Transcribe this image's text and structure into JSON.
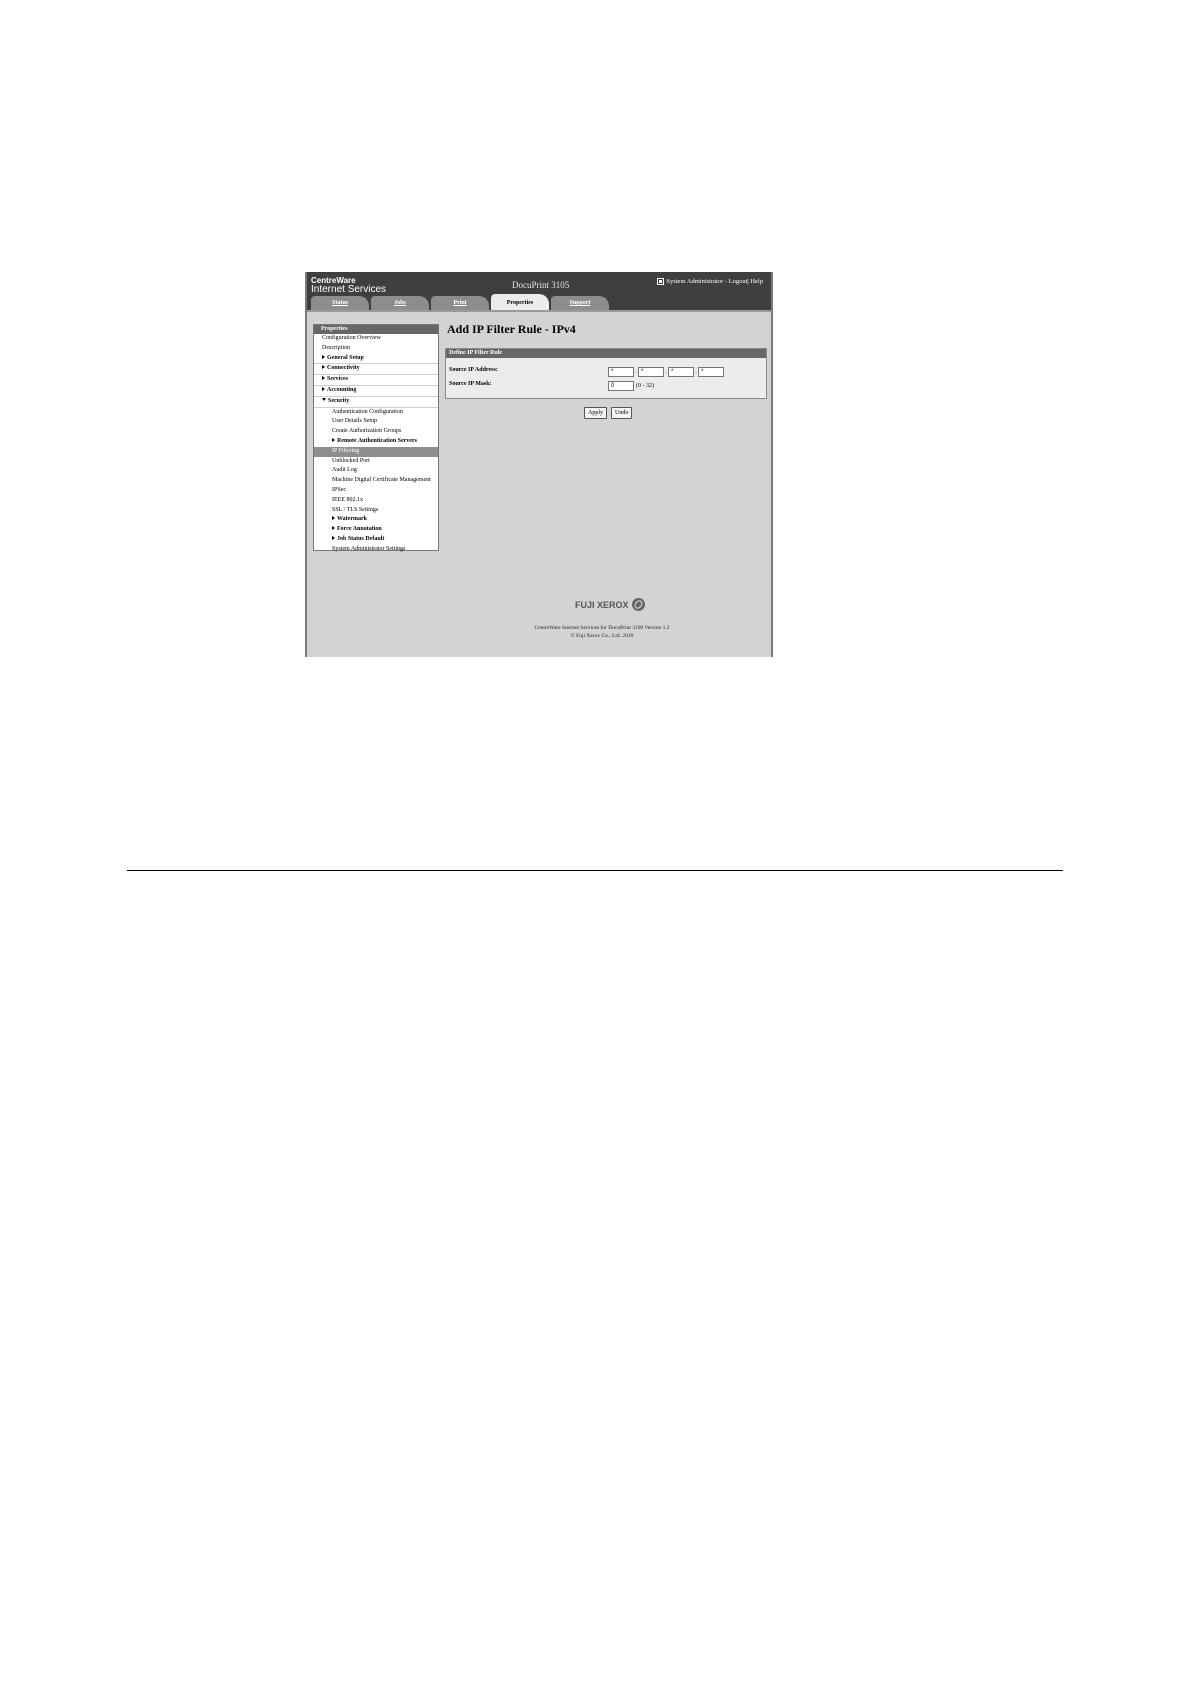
{
  "app": {
    "logo_line1": "CentreWare",
    "logo_line2": "Internet Services",
    "product": "DocuPrint 3105",
    "user_text": "System Administrator - Logout| Help"
  },
  "tabs": [
    {
      "label": "Status",
      "active": false
    },
    {
      "label": "Jobs",
      "active": false
    },
    {
      "label": "Print",
      "active": false
    },
    {
      "label": "Properties",
      "active": true
    },
    {
      "label": "Support",
      "active": false
    }
  ],
  "sidebar": {
    "header": "Properties",
    "items": [
      {
        "label": "Configuration Overview",
        "level": 1,
        "bold": false,
        "expand": "",
        "selected": false
      },
      {
        "label": "Description",
        "level": 1,
        "bold": false,
        "expand": "",
        "selected": false
      },
      {
        "label": "General Setup",
        "level": 1,
        "bold": true,
        "expand": "right",
        "selected": false
      },
      {
        "label": "Connectivity",
        "level": 1,
        "bold": true,
        "expand": "right",
        "selected": false
      },
      {
        "label": "Services",
        "level": 1,
        "bold": true,
        "expand": "right",
        "selected": false
      },
      {
        "label": "Accounting",
        "level": 1,
        "bold": true,
        "expand": "right",
        "selected": false
      },
      {
        "label": "Security",
        "level": 1,
        "bold": true,
        "expand": "down",
        "selected": false
      },
      {
        "label": "Authentication Configuration",
        "level": 2,
        "bold": false,
        "expand": "",
        "selected": false
      },
      {
        "label": "User Details Setup",
        "level": 2,
        "bold": false,
        "expand": "",
        "selected": false
      },
      {
        "label": "Create Authorization Groups",
        "level": 2,
        "bold": false,
        "expand": "",
        "selected": false
      },
      {
        "label": "Remote Authentication Servers",
        "level": 2,
        "bold": true,
        "expand": "right",
        "selected": false
      },
      {
        "label": "IP Filtering",
        "level": 2,
        "bold": false,
        "expand": "",
        "selected": true
      },
      {
        "label": "Unblocked Port",
        "level": 2,
        "bold": false,
        "expand": "",
        "selected": false
      },
      {
        "label": "Audit Log",
        "level": 2,
        "bold": false,
        "expand": "",
        "selected": false
      },
      {
        "label": "Machine Digital Certificate Management",
        "level": 2,
        "bold": false,
        "expand": "",
        "selected": false
      },
      {
        "label": "IPSec",
        "level": 2,
        "bold": false,
        "expand": "",
        "selected": false
      },
      {
        "label": "IEEE 802.1x",
        "level": 2,
        "bold": false,
        "expand": "",
        "selected": false
      },
      {
        "label": "SSL / TLS Settings",
        "level": 2,
        "bold": false,
        "expand": "",
        "selected": false
      },
      {
        "label": "Watermark",
        "level": 2,
        "bold": true,
        "expand": "right",
        "selected": false
      },
      {
        "label": "Force Annotation",
        "level": 2,
        "bold": true,
        "expand": "right",
        "selected": false
      },
      {
        "label": "Job Status Default",
        "level": 2,
        "bold": true,
        "expand": "right",
        "selected": false
      },
      {
        "label": "System Administrator Settings",
        "level": 2,
        "bold": false,
        "expand": "",
        "selected": false
      }
    ]
  },
  "main": {
    "title": "Add IP Filter Rule - IPv4",
    "panel_header": "Define IP Filter Rule",
    "source_ip_label": "Source IP Address:",
    "source_ip_octets": [
      "*",
      "*",
      "*",
      "*"
    ],
    "source_mask_label": "Source IP Mask:",
    "source_mask_value": "0",
    "source_mask_range": "(0 - 32)",
    "apply_label": "Apply",
    "undo_label": "Undo"
  },
  "footer": {
    "brand": "FUJI XEROX",
    "line1": "CentreWare Internet Services for DocuPrint 3100 Version 1.2",
    "line2": "© Fuji Xerox Co., Ltd. 2010"
  }
}
